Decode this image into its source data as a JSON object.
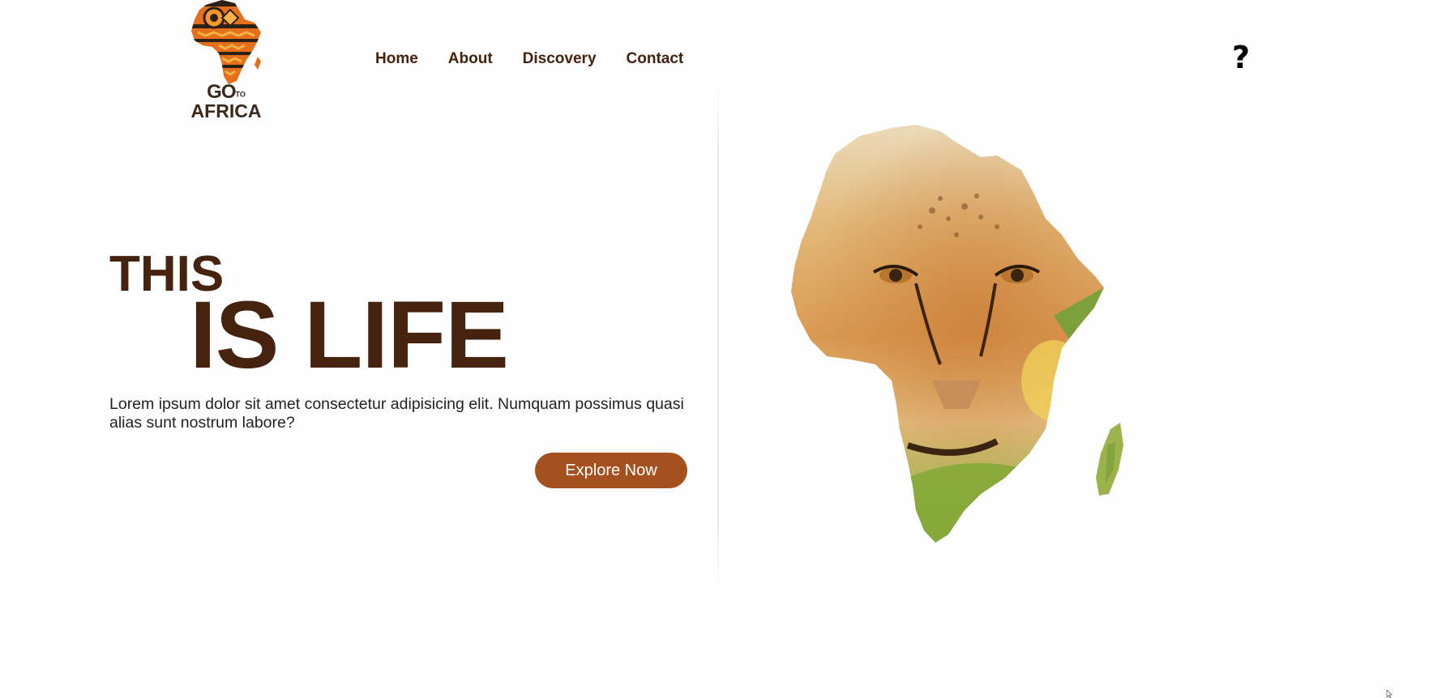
{
  "header": {
    "logo": {
      "line1": "GO",
      "line1_small": "TO",
      "line2": "AFRICA"
    },
    "nav": [
      {
        "label": "Home"
      },
      {
        "label": "About"
      },
      {
        "label": "Discovery"
      },
      {
        "label": "Contact"
      }
    ],
    "help_icon": "question-mark-icon",
    "help_glyph": "?"
  },
  "hero": {
    "title_small": "THIS",
    "title_large": "IS LIFE",
    "description": "Lorem ipsum dolor sit amet consectetur adipisicing elit. Numquam possimus quasi alias sunt nostrum labore?",
    "cta_label": "Explore Now"
  },
  "colors": {
    "brand_brown": "#45230f",
    "button": "#a5511f",
    "background": "#fefefe"
  }
}
